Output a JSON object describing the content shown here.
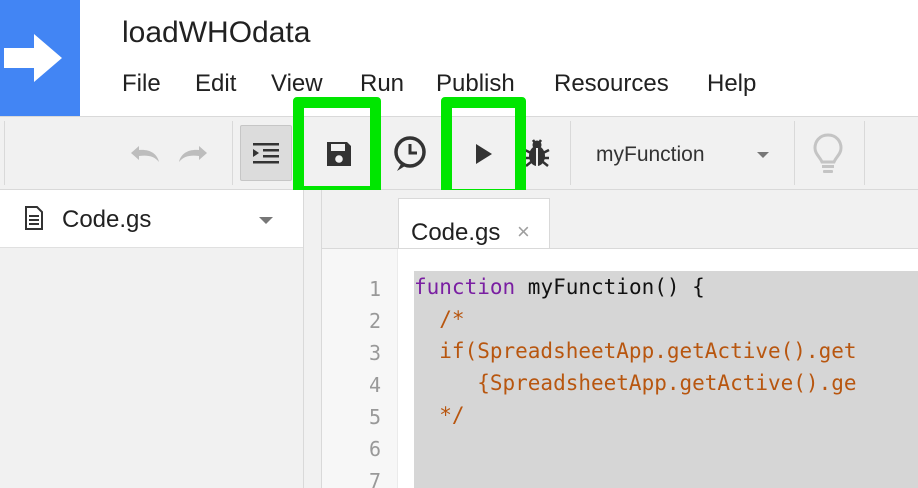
{
  "app": {
    "project_title": "loadWHOdata"
  },
  "menu": {
    "items": [
      "File",
      "Edit",
      "View",
      "Run",
      "Publish",
      "Resources",
      "Help"
    ]
  },
  "toolbar": {
    "selected_function": "myFunction"
  },
  "files": {
    "current": "Code.gs"
  },
  "editor": {
    "tab_label": "Code.gs",
    "tab_close": "×",
    "line_numbers": [
      "1",
      "2",
      "3",
      "4",
      "5",
      "6",
      "7"
    ],
    "lines": [
      {
        "keyword": "function",
        "rest": " myFunction() {",
        "comment": ""
      },
      {
        "keyword": "",
        "rest": "",
        "comment": "  /*"
      },
      {
        "keyword": "",
        "rest": "",
        "comment": "  if(SpreadsheetApp.getActive().get"
      },
      {
        "keyword": "",
        "rest": "",
        "comment": "     {SpreadsheetApp.getActive().ge"
      },
      {
        "keyword": "",
        "rest": "",
        "comment": "  */"
      },
      {
        "keyword": "",
        "rest": "",
        "comment": ""
      },
      {
        "keyword": "",
        "rest": "",
        "comment": ""
      }
    ]
  },
  "colors": {
    "logo": "#4285f4",
    "highlight": "#00e600",
    "keyword": "#7a1fa2",
    "comment": "#b8560f",
    "selection": "#d6d6d6"
  },
  "icons": {
    "logo": "arrow-right-icon",
    "undo": "undo-icon",
    "redo": "redo-icon",
    "indent": "indent-icon",
    "save": "save-icon",
    "triggers": "clock-icon",
    "run": "play-icon",
    "debug": "bug-icon",
    "select_arrow": "chevron-down-icon",
    "execution_hints": "lightbulb-icon",
    "file": "document-icon",
    "file_menu": "chevron-down-icon"
  }
}
